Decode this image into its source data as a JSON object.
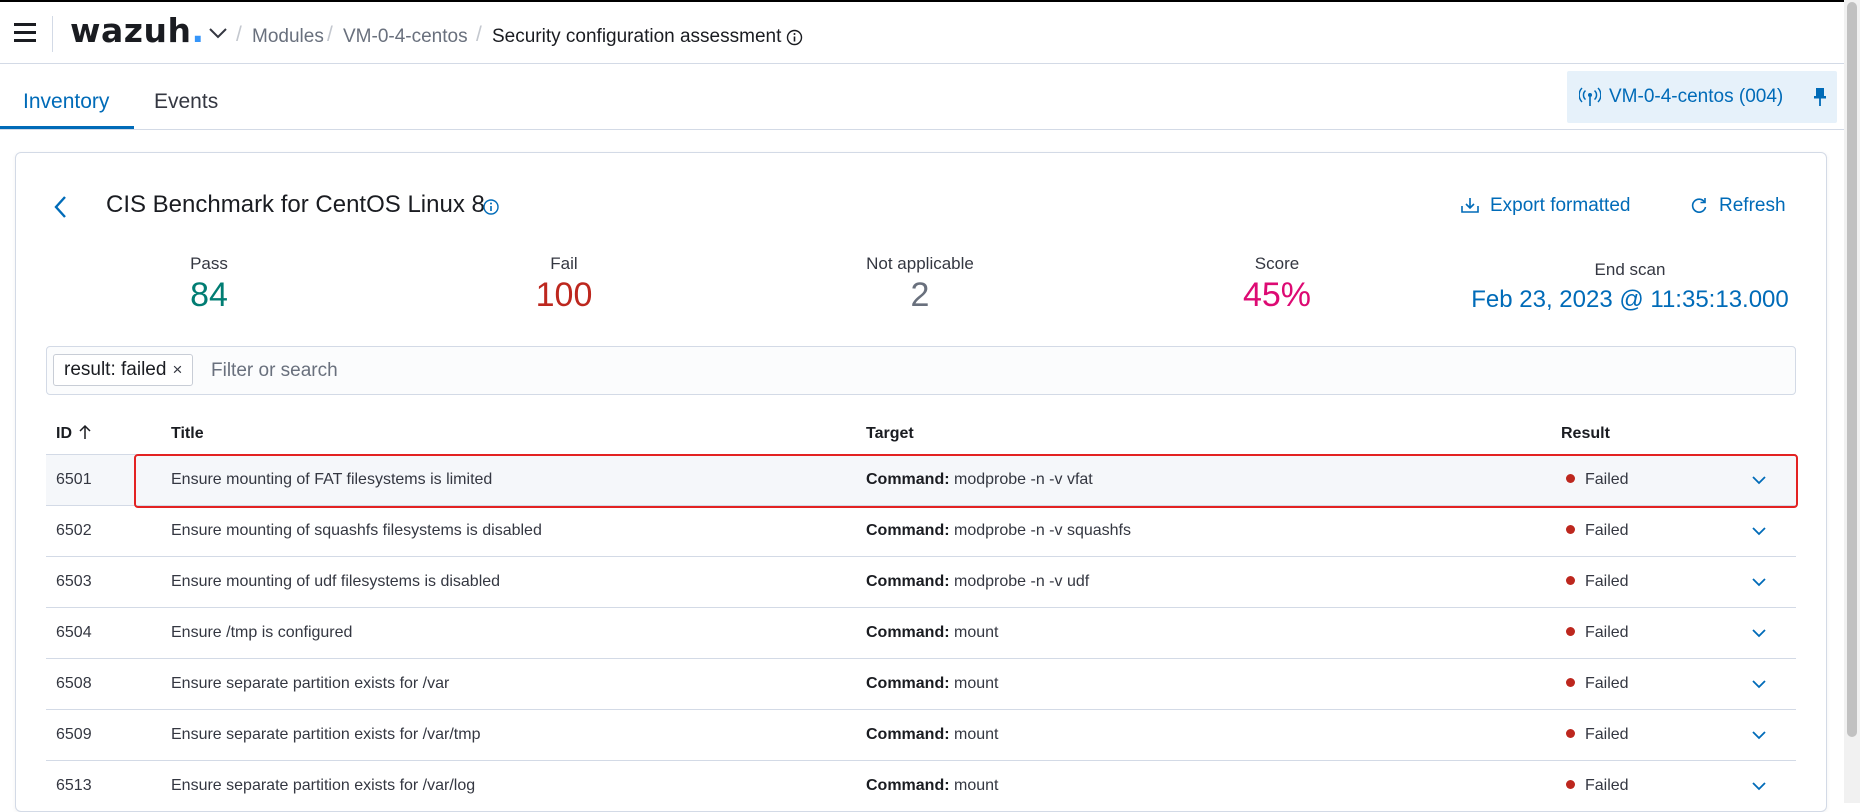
{
  "header": {
    "logo": {
      "text": "wazuh",
      "dot": "."
    },
    "breadcrumb": {
      "modules": "Modules",
      "agent": "VM-0-4-centos",
      "current": "Security configuration assessment",
      "separator": "/"
    }
  },
  "tabs": [
    {
      "label": "Inventory",
      "active": true
    },
    {
      "label": "Events",
      "active": false
    }
  ],
  "agent_badge": {
    "label": "VM-0-4-centos (004)",
    "icon": "antenna-icon",
    "pin_icon": "pin-icon"
  },
  "policy": {
    "title": "CIS Benchmark for CentOS Linux 8",
    "export_label": "Export formatted",
    "refresh_label": "Refresh"
  },
  "stats": {
    "pass": {
      "label": "Pass",
      "value": "84"
    },
    "fail": {
      "label": "Fail",
      "value": "100"
    },
    "not_applicable": {
      "label": "Not applicable",
      "value": "2"
    },
    "score": {
      "label": "Score",
      "value": "45%"
    },
    "end_scan": {
      "label": "End scan",
      "value": "Feb 23, 2023 @ 11:35:13.000"
    }
  },
  "search": {
    "filter_pill": "result: failed",
    "filter_remove": "×",
    "placeholder": "Filter or search"
  },
  "table": {
    "columns": {
      "id": "ID",
      "title": "Title",
      "target": "Target",
      "result": "Result"
    },
    "rows": [
      {
        "id": "6501",
        "title": "Ensure mounting of FAT filesystems is limited",
        "target_label": "Command:",
        "target_value": "modprobe -n -v vfat",
        "result": "Failed"
      },
      {
        "id": "6502",
        "title": "Ensure mounting of squashfs filesystems is disabled",
        "target_label": "Command:",
        "target_value": "modprobe -n -v squashfs",
        "result": "Failed"
      },
      {
        "id": "6503",
        "title": "Ensure mounting of udf filesystems is disabled",
        "target_label": "Command:",
        "target_value": "modprobe -n -v udf",
        "result": "Failed"
      },
      {
        "id": "6504",
        "title": "Ensure /tmp is configured",
        "target_label": "Command:",
        "target_value": "mount",
        "result": "Failed"
      },
      {
        "id": "6508",
        "title": "Ensure separate partition exists for /var",
        "target_label": "Command:",
        "target_value": "mount",
        "result": "Failed"
      },
      {
        "id": "6509",
        "title": "Ensure separate partition exists for /var/tmp",
        "target_label": "Command:",
        "target_value": "mount",
        "result": "Failed"
      },
      {
        "id": "6513",
        "title": "Ensure separate partition exists for /var/log",
        "target_label": "Command:",
        "target_value": "mount",
        "result": "Failed"
      }
    ]
  },
  "colors": {
    "accent": "#006bb8",
    "pass": "#017d73",
    "fail": "#bd271e",
    "not_applicable": "#69707d",
    "score": "#dd0a73",
    "highlight": "#e32222"
  }
}
